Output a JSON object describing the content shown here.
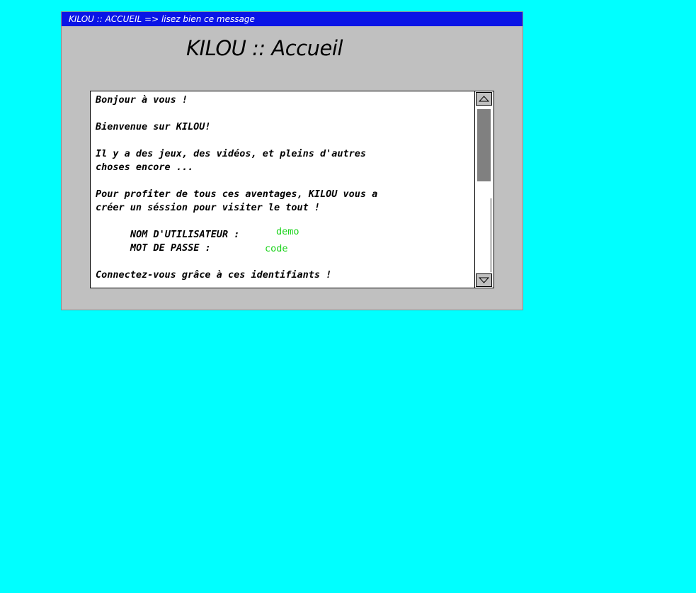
{
  "window": {
    "title": "KILOU :: ACCUEIL => lisez bien ce message"
  },
  "heading": "KILOU :: Accueil",
  "message": {
    "greeting": "Bonjour à vous !",
    "welcome": "Bienvenue sur KILOU!",
    "line3a": "Il y a des jeux, des vidéos, et pleins d'autres",
    "line3b": "choses encore ...",
    "line4a": "Pour profiter de tous ces aventages, KILOU vous a",
    "line4b": "créer un séssion pour visiter le tout !",
    "username_label": "NOM D'UTILISATEUR :",
    "username_value": "demo",
    "password_label": "MOT DE PASSE :",
    "password_value": "code",
    "connect": "Connectez-vous grâce à ces identifiants !"
  },
  "colors": {
    "page_background": "#00ffff",
    "window_background": "#c0c0c0",
    "titlebar_background": "#0a14e6",
    "credential_value": "#19d219"
  },
  "scrollbar": {
    "up_icon": "arrow-up-icon",
    "down_icon": "arrow-down-icon"
  }
}
